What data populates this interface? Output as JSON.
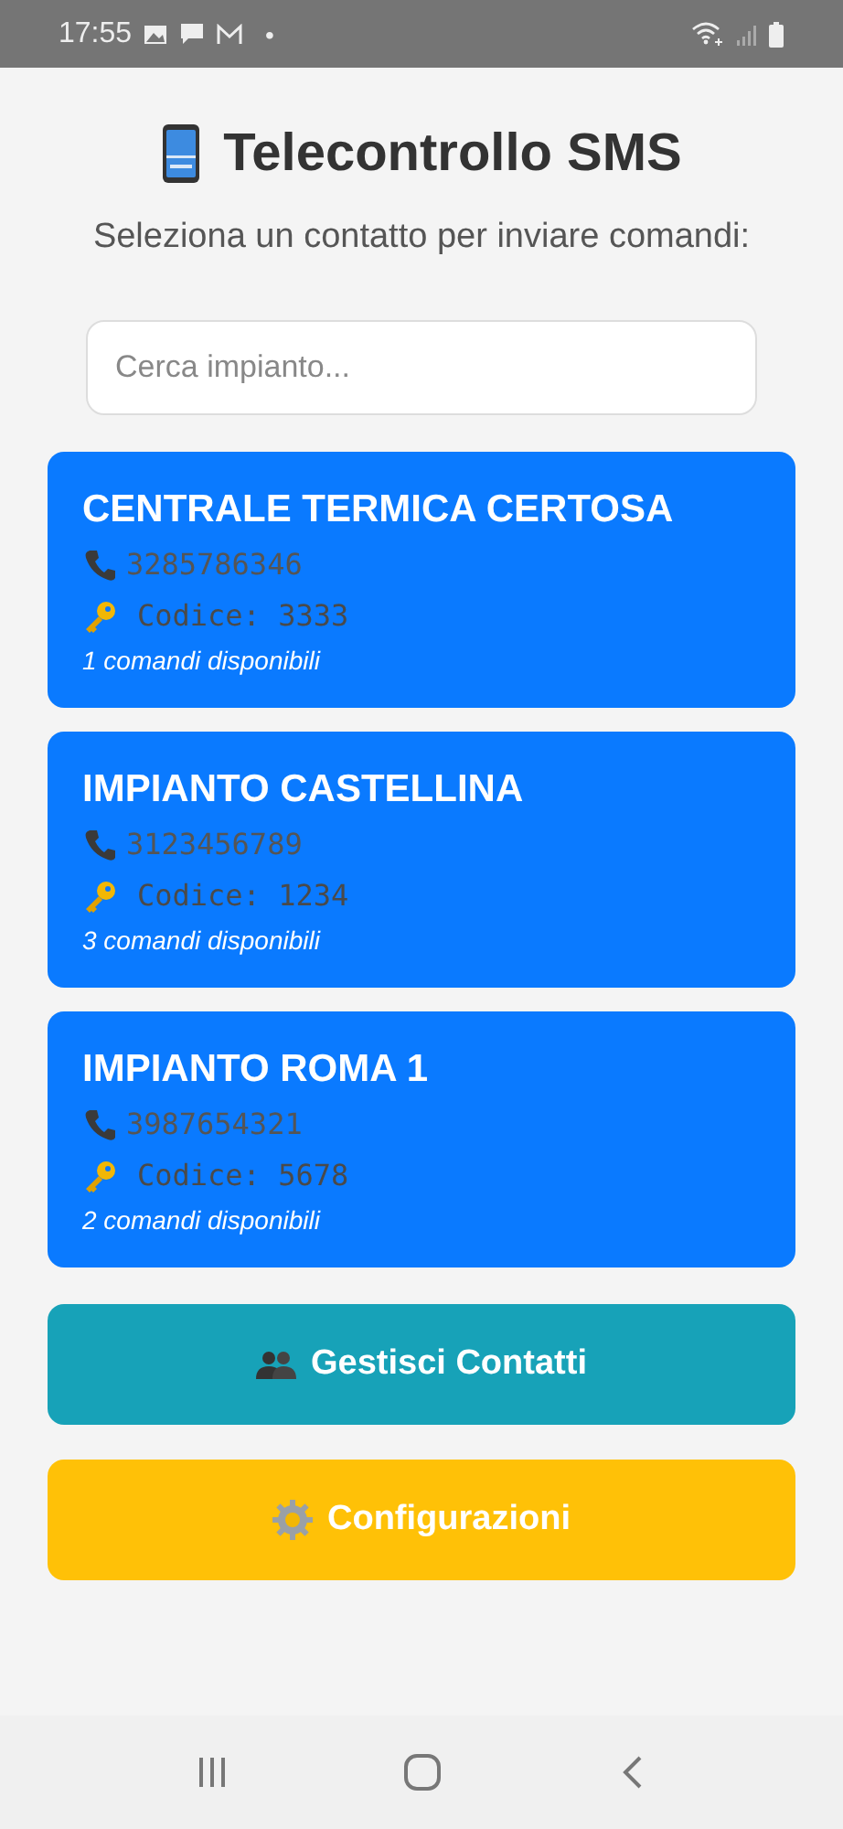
{
  "status_bar": {
    "time": "17:55",
    "dot": "•"
  },
  "header": {
    "title": "Telecontrollo SMS",
    "subtitle": "Seleziona un contatto per inviare comandi:"
  },
  "search": {
    "placeholder": "Cerca impianto..."
  },
  "contacts": [
    {
      "name": "CENTRALE TERMICA CERTOSA",
      "phone": "3285786346",
      "code": "Codice: 3333",
      "commands": "1 comandi disponibili"
    },
    {
      "name": "IMPIANTO CASTELLINA",
      "phone": "3123456789",
      "code": "Codice: 1234",
      "commands": "3 comandi disponibili"
    },
    {
      "name": "IMPIANTO ROMA 1",
      "phone": "3987654321",
      "code": "Codice: 5678",
      "commands": "2 comandi disponibili"
    }
  ],
  "buttons": [
    {
      "kind": "contacts",
      "label": "Gestisci Contatti"
    },
    {
      "kind": "settings",
      "label": "Configurazioni"
    }
  ]
}
